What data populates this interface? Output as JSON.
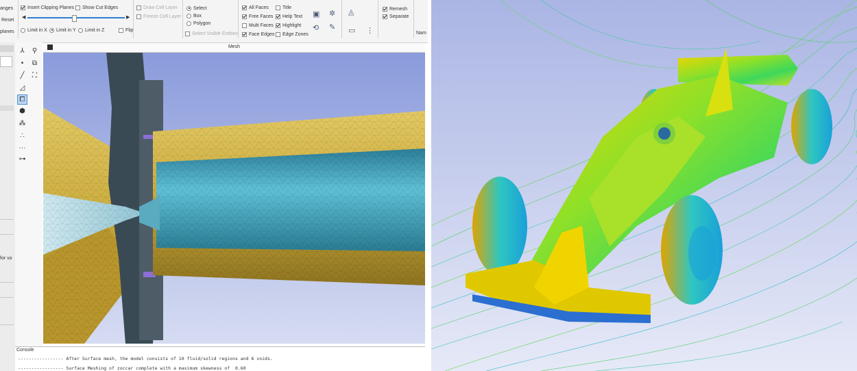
{
  "ribbon": {
    "left_labels": [
      "anges",
      "Reset",
      "planes"
    ],
    "clip": {
      "insert_clipping_planes": "Insert Clipping Planes",
      "show_cut_edges": "Show Cut Edges",
      "limit_x": "Limit in X",
      "limit_y": "Limit in Y",
      "limit_z": "Limit in Z",
      "flip": "Flip",
      "slider_percent": 48
    },
    "cell": {
      "draw_cell_layer": "Draw Cell Layer",
      "freeze_cell_layer": "Freeze Cell Layer"
    },
    "selection": {
      "select": "Select",
      "box": "Box",
      "polygon": "Polygon",
      "select_visible_entities": "Select Visible Entities"
    },
    "faces": {
      "all_faces": "All Faces",
      "free_faces": "Free Faces",
      "multi_faces": "Multi Faces",
      "face_edges": "Face Edges"
    },
    "display": {
      "title": "Title",
      "help_text": "Help Text",
      "highlight": "Highlight",
      "edge_zones": "Edge Zones"
    },
    "options": {
      "remesh": "Remesh",
      "separate": "Separate",
      "name_stub": "Nam"
    }
  },
  "sidebar": {
    "label_for": "for vo"
  },
  "viewport": {
    "title": "Mesh"
  },
  "console": {
    "title": "Console",
    "lines": [
      "----------------- After Surface mesh, the model consists of 10 fluid/solid regions and 6 voids.",
      "----------------- Surface Meshing of zoccar complete with a maximum skewness of  0.60"
    ]
  },
  "colors": {
    "mesh_gold": "#c8a93a",
    "mesh_teal": "#3a9fb8",
    "mesh_dark": "#3a4a55",
    "viewport_top": "#8a9bdb",
    "cfd_background": "#c5cceb"
  },
  "icons": [
    "check-icon",
    "radio-icon",
    "zoom-icon",
    "snowflake-icon",
    "rotate-icon",
    "pen-icon",
    "node-icon",
    "select-tool-icon",
    "cube-icon",
    "stack-icon"
  ]
}
